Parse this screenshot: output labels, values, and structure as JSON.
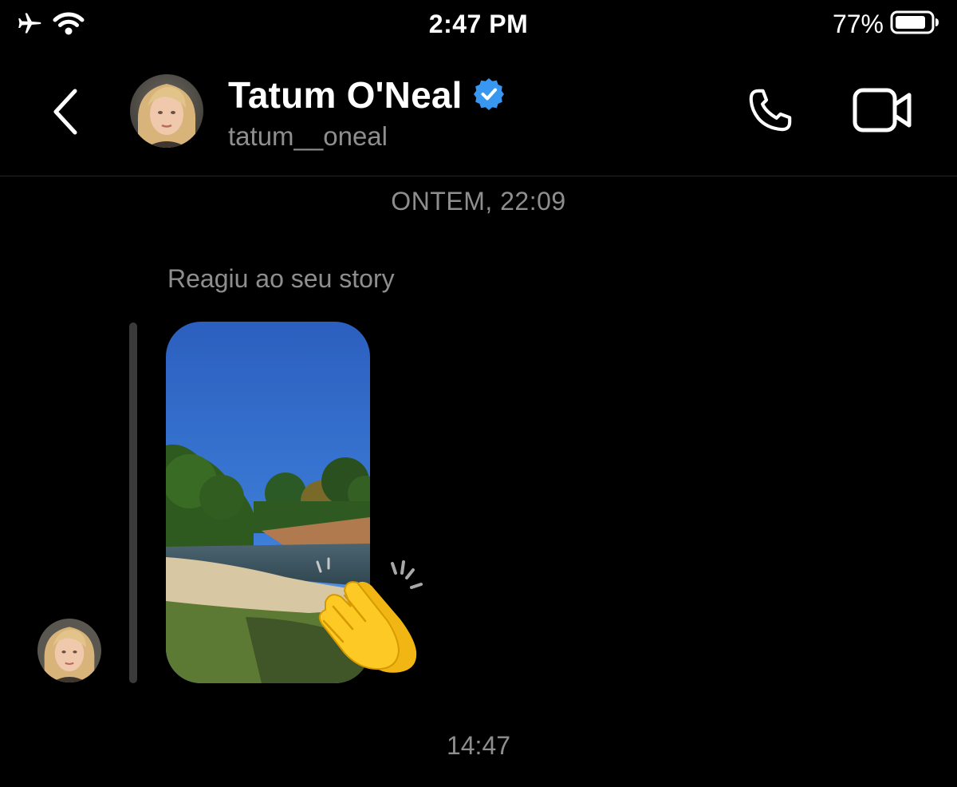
{
  "status_bar": {
    "time": "2:47 PM",
    "battery_percent": "77%",
    "icons": [
      "airplane-icon",
      "wifi-icon",
      "battery-icon"
    ]
  },
  "header": {
    "contact_name": "Tatum O'Neal",
    "username": "tatum__oneal",
    "verified": true,
    "icons": [
      "back-chevron-icon",
      "phone-call-icon",
      "video-call-icon",
      "verified-badge-icon"
    ]
  },
  "chat": {
    "date_divider": "ONTEM, 22:09",
    "reply_label": "Reagiu ao seu story",
    "reaction_emoji": "clapping-hands",
    "message_time": "14:47"
  },
  "colors": {
    "background": "#000000",
    "secondary_text": "#8e8e8e",
    "verified_blue": "#3897f0",
    "reply_bar": "#3a3a3a"
  }
}
